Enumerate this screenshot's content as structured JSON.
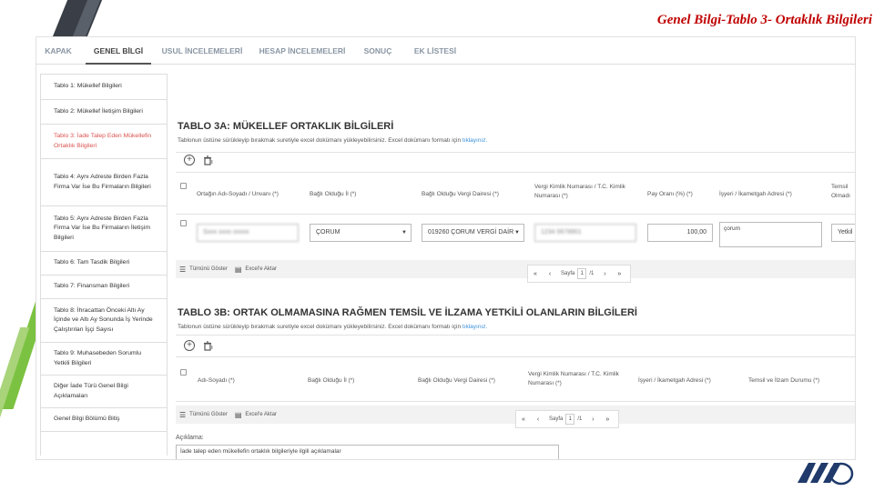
{
  "slide": {
    "title": "Genel Bilgi-Tablo 3- Ortaklık Bilgileri"
  },
  "tabs": [
    {
      "label": "KAPAK"
    },
    {
      "label": "GENEL BİLGİ"
    },
    {
      "label": "USUL İNCELEMELERİ"
    },
    {
      "label": "HESAP İNCELEMELERİ"
    },
    {
      "label": "SONUÇ"
    },
    {
      "label": "EK LİSTESİ"
    }
  ],
  "active_tab": "GENEL BİLGİ",
  "sidebar": {
    "items": [
      {
        "label": "Tablo 1: Mükellef Bilgileri"
      },
      {
        "label": "Tablo 2: Mükellef İletişim Bilgileri"
      },
      {
        "label": "Tablo 3: İade Talep Eden Mükellefin Ortaklık Bilgileri"
      },
      {
        "label": "Tablo 4: Aynı Adreste Birden Fazla Firma Var İse Bu Firmaların Bilgileri"
      },
      {
        "label": "Tablo 5: Aynı Adreste Birden Fazla Firma Var İse Bu Firmaların İletişim Bilgileri"
      },
      {
        "label": "Tablo 6: Tam Tasdik Bilgileri"
      },
      {
        "label": "Tablo 7: Finansman Bilgileri"
      },
      {
        "label": "Tablo 8: İhracattan Önceki Altı Ay İçinde ve Altı Ay Sonunda İş Yerinde Çalıştırılan İşçi Sayısı"
      },
      {
        "label": "Tablo 9: Muhasebeden Sorumlu Yetkili Bilgileri"
      },
      {
        "label": "Diğer İade Türü Genel Bilgi Açıklamaları"
      },
      {
        "label": "Genel Bilgi Bölümü Bitiş"
      }
    ],
    "active_index": 2
  },
  "table3a": {
    "title": "TABLO 3A: MÜKELLEF ORTAKLIK BİLGİLERİ",
    "desc": "Tablonun üstüne sürükleyip bırakmak suretiyle excel dokümanı yükleyebilirsiniz. Excel dokümanı formatı için",
    "link": "tıklayınız.",
    "headers": [
      "Ortağın Adı-Soyadı / Unvanı (*)",
      "Bağlı Olduğu İl (*)",
      "Bağlı Olduğu Vergi Dairesi (*)",
      "Vergi Kimlik Numarası / T.C. Kimlik Numarası (*)",
      "Pay Oranı (%) (*)",
      "İşyeri / İkametgah Adresi (*)",
      "Temsil Olmadı"
    ],
    "row": {
      "name": "Sxxx xxxx xxxxx",
      "il": "ÇORUM",
      "vergi_dairesi": "019260 ÇORUM VERGİ DAİR",
      "vkn": "1234 5678901",
      "pay": "100,00",
      "adres": "çorum",
      "temsil": "Yetkil"
    },
    "buttons": {
      "show_all": "Tümünü Göster",
      "excel": "Excel'e Aktar"
    },
    "pager": {
      "page_label": "Sayfa",
      "page": "1",
      "total": "/1"
    }
  },
  "table3b": {
    "title": "TABLO 3B: ORTAK OLMAMASINA RAĞMEN TEMSİL VE İLZAMA YETKİLİ OLANLARIN BİLGİLERİ",
    "desc": "Tablonun üstüne sürükleyip bırakmak suretiyle excel dokümanı yükleyebilirsiniz. Excel dokümanı formatı için",
    "link": "tıklayınız.",
    "headers": [
      "Adı-Soyadı (*)",
      "Bağlı Olduğu İl (*)",
      "Bağlı Olduğu Vergi Dairesi (*)",
      "Vergi Kimlik Numarası / T.C. Kimlik Numarası (*)",
      "İşyeri / İkametgah Adresi (*)",
      "Temsil ve İlzam Durumu (*)"
    ],
    "buttons": {
      "show_all": "Tümünü Göster",
      "excel": "Excel'e Aktar"
    },
    "pager": {
      "page_label": "Sayfa",
      "page": "1",
      "total": "/1"
    }
  },
  "aciklama": {
    "label": "Açıklama:",
    "value": "İade talep eden mükellefin ortaklık bilgileriyle ilgili açıklamalar"
  },
  "colors": {
    "title_red": "#c00000",
    "active_side": "#d9534f",
    "link": "#3a8fd9",
    "stripe_dark": "#3a3f47",
    "stripe_green": "#7cc242"
  },
  "icons": [
    "plus-circle-icon",
    "trash-icon",
    "list-icon",
    "excel-icon",
    "first-page-icon",
    "prev-page-icon",
    "next-page-icon",
    "last-page-icon",
    "ymm-logo"
  ]
}
